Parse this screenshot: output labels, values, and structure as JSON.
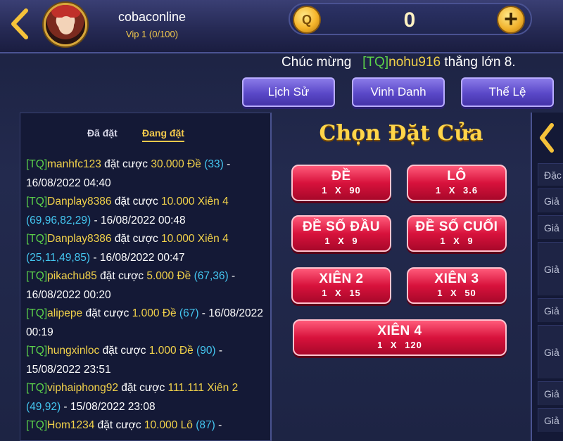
{
  "header": {
    "username": "cobaconline",
    "vip": "Vip 1 (0/100)",
    "coin_symbol": "Q",
    "balance": "0",
    "plus_symbol": "+"
  },
  "ticker": {
    "prefix": "Chúc mừng",
    "tag": "[TQ]",
    "name": "nohu916",
    "suffix": "thắng lớn 8."
  },
  "nav": {
    "history": "Lịch Sử",
    "honor": "Vinh Danh",
    "rules": "Thể Lệ"
  },
  "left_panel": {
    "tab_placed": "Đã đặt",
    "tab_placing": "Đang đặt",
    "bets": [
      {
        "tag": "[TQ]",
        "name": "manhfc123",
        "action": "đặt cược",
        "amount": "30.000",
        "type": "Đề",
        "nums": "(33)",
        "sep": " -",
        "time": "16/08/2022 04:40"
      },
      {
        "tag": "[TQ]",
        "name": "Danplay8386",
        "action": "đặt cược",
        "amount": "10.000",
        "type": "Xiên 4",
        "nums": "(69,96,82,29)",
        "sep": " -",
        "time": "16/08/2022 00:48"
      },
      {
        "tag": "[TQ]",
        "name": "Danplay8386",
        "action": "đặt cược",
        "amount": "10.000",
        "type": "Xiên 4",
        "nums": "(25,11,49,85)",
        "sep": " -",
        "time": "16/08/2022 00:47"
      },
      {
        "tag": "[TQ]",
        "name": "pikachu85",
        "action": "đặt cược",
        "amount": "5.000",
        "type": "Đề",
        "nums": "(67,36)",
        "sep": " -",
        "time": "16/08/2022 00:20"
      },
      {
        "tag": "[TQ]",
        "name": "alipepe",
        "action": "đặt cược",
        "amount": "1.000",
        "type": "Đề",
        "nums": "(67)",
        "sep": " -",
        "time": "16/08/2022 00:19"
      },
      {
        "tag": "[TQ]",
        "name": "hungxinloc",
        "action": "đặt cược",
        "amount": "1.000",
        "type": "Đề",
        "nums": "(90)",
        "sep": " -",
        "time": "15/08/2022 23:51"
      },
      {
        "tag": "[TQ]",
        "name": "viphaiphong92",
        "action": "đặt cược",
        "amount": "111.111",
        "type": "Xiên 2",
        "nums": "(49,92)",
        "sep": " -",
        "time": "15/08/2022 23:08"
      },
      {
        "tag": "[TQ]",
        "name": "Hom1234",
        "action": "đặt cược",
        "amount": "10.000",
        "type": "Lô",
        "nums": "(87)",
        "sep": " -",
        "time": ""
      }
    ]
  },
  "center": {
    "title": "Chọn Đặt Cửa",
    "options": [
      {
        "label": "ĐỀ",
        "odds": "1 X 90"
      },
      {
        "label": "LÔ",
        "odds": "1 X 3.6"
      },
      {
        "label": "ĐỀ SỐ ĐẦU",
        "odds": "1 X 9"
      },
      {
        "label": "ĐỀ SỐ CUỐI",
        "odds": "1 X 9"
      },
      {
        "label": "XIÊN 2",
        "odds": "1 X 15"
      },
      {
        "label": "XIÊN 3",
        "odds": "1 X 50"
      },
      {
        "label": "XIÊN 4",
        "odds": "1 X 120"
      }
    ]
  },
  "right_panel": {
    "rows": [
      "Đặc",
      "Giả",
      "Giả",
      "Giả",
      "Giả",
      "Giả",
      "Giả",
      "Giả"
    ]
  },
  "colors": {
    "tag_green": "#5bd24a",
    "name_yellow": "#f2d24a",
    "nums_blue": "#44c6f0",
    "button_red": "#d8123c",
    "nav_purple": "#5a48c8"
  }
}
